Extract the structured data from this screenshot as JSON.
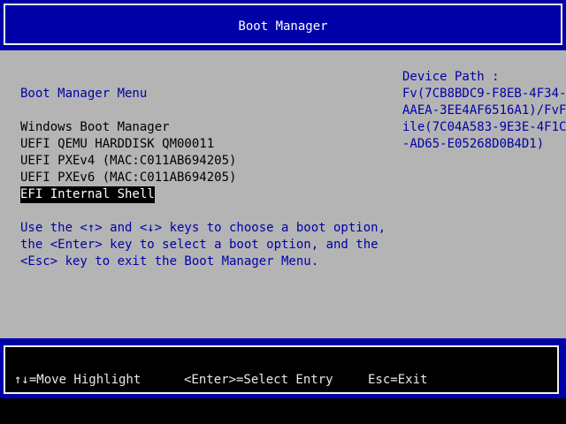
{
  "header": {
    "title": "Boot Manager"
  },
  "menu": {
    "title": "Boot Manager Menu",
    "items": [
      {
        "label": "Windows Boot Manager",
        "selected": false
      },
      {
        "label": "UEFI QEMU HARDDISK QM00011",
        "selected": false
      },
      {
        "label": "UEFI PXEv4 (MAC:C011AB694205)",
        "selected": false
      },
      {
        "label": "UEFI PXEv6 (MAC:C011AB694205)",
        "selected": false
      },
      {
        "label": "EFI Internal Shell",
        "selected": true
      }
    ],
    "help_lines": [
      "Use the <↑> and <↓> keys to choose a boot option,",
      "the <Enter> key to select a boot option, and the",
      "<Esc> key to exit the Boot Manager Menu."
    ]
  },
  "device_path": {
    "label": "Device Path :",
    "lines": [
      "Fv(7CB8BDC9-F8EB-4F34-",
      "AAEA-3EE4AF6516A1)/FvF",
      "ile(7C04A583-9E3E-4F1C",
      "-AD65-E05268D0B4D1)"
    ]
  },
  "footer": {
    "move": "↑↓=Move Highlight",
    "select": "<Enter>=Select Entry",
    "exit": "Esc=Exit"
  },
  "colors": {
    "header_blue": "#0000a8",
    "content_gray": "#b4b4b4",
    "highlight_bg": "#000000",
    "highlight_fg": "#ffffff"
  }
}
